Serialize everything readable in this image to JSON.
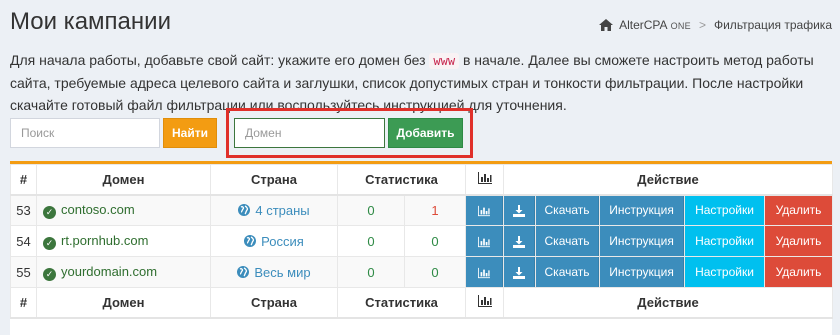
{
  "header": {
    "title": "Мои кампании",
    "breadcrumb": {
      "root": "AlterCPA",
      "root_suffix": "ONE",
      "sep": ">",
      "current": "Фильтрация трафика"
    }
  },
  "intro": {
    "text_before": "Для начала работы, добавьте свой сайт: укажите его домен без ",
    "code": "www",
    "text_after": " в начале. Далее вы сможете настроить метод работы сайта, требуемые адреса целевого сайта и заглушки, список допустимых стран и тонкости фильтрации. После настройки скачайте готовый файл фильтрации или воспользуйтесь инструкцией для уточнения."
  },
  "search": {
    "placeholder": "Поиск",
    "value": "",
    "button": "Найти"
  },
  "add": {
    "placeholder": "Домен",
    "value": "",
    "button": "Добавить"
  },
  "table": {
    "headers": {
      "num": "#",
      "domain": "Домен",
      "country": "Страна",
      "stats": "Статистика",
      "action": "Действие"
    },
    "rows": [
      {
        "id": "53",
        "domain": "contoso.com",
        "country": "4 страны",
        "stat_ok": "0",
        "stat_bad": "1"
      },
      {
        "id": "54",
        "domain": "rt.pornhub.com",
        "country": "Россия",
        "stat_ok": "0",
        "stat_bad": "0"
      },
      {
        "id": "55",
        "domain": "yourdomain.com",
        "country": "Весь мир",
        "stat_ok": "0",
        "stat_bad": "0"
      }
    ],
    "actions": {
      "download": "Скачать",
      "instruction": "Инструкция",
      "settings": "Настройки",
      "delete": "Удалить"
    }
  },
  "colors": {
    "accent": "#f39c12",
    "primary": "#3c8dbc",
    "success": "#3c9b54",
    "info": "#00c0ef",
    "danger": "#dd4b39",
    "highlight": "#e0302a"
  },
  "icons": {
    "home": "home-icon",
    "check": "check-circle-icon",
    "globe": "globe-icon",
    "chart": "bar-chart-icon",
    "download": "download-icon"
  }
}
